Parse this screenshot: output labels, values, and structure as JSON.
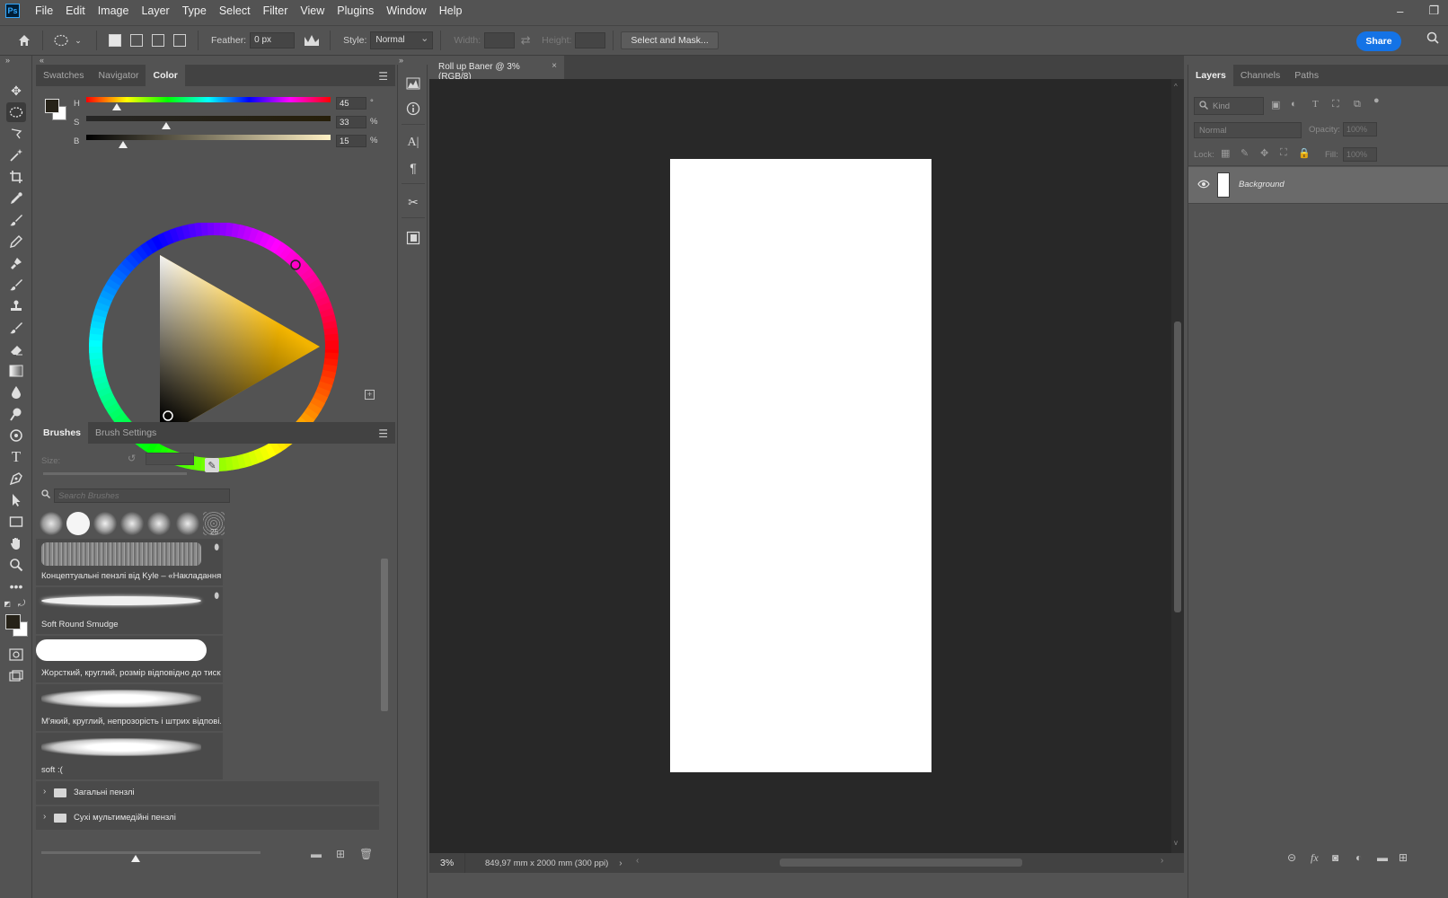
{
  "app": {
    "logo": "Ps",
    "menu": [
      "File",
      "Edit",
      "Image",
      "Layer",
      "Type",
      "Select",
      "Filter",
      "View",
      "Plugins",
      "Window",
      "Help"
    ],
    "window_controls": {
      "minimize": "–",
      "restore": "❐"
    }
  },
  "options_bar": {
    "feather_label": "Feather:",
    "feather_value": "0 px",
    "style_label": "Style:",
    "style_value": "Normal",
    "width_label": "Width:",
    "height_label": "Height:",
    "select_mask_label": "Select and Mask...",
    "share_label": "Share"
  },
  "color_panel": {
    "tabs": [
      "Swatches",
      "Navigator",
      "Color"
    ],
    "active_tab": "Color",
    "h": {
      "letter": "H",
      "value": "45",
      "unit": "°"
    },
    "s": {
      "letter": "S",
      "value": "33",
      "unit": "%"
    },
    "b": {
      "letter": "B",
      "value": "15",
      "unit": "%"
    },
    "foreground_color": "#262218",
    "background_color": "#ffffff"
  },
  "brushes_panel": {
    "tabs": [
      "Brushes",
      "Brush Settings"
    ],
    "active_tab": "Brushes",
    "size_label": "Size:",
    "search_placeholder": "Search Brushes",
    "recent_size_label": "25",
    "brushes": [
      {
        "name": "Концептуальні пензлі від Kyle – «Накладання ..."
      },
      {
        "name": "Soft Round Smudge"
      },
      {
        "name": "Жорсткий, круглий, розмір відповідно до тиску"
      },
      {
        "name": "М'який, круглий, непрозорість і штрих відпові..."
      },
      {
        "name": "soft :("
      }
    ],
    "groups": [
      {
        "name": "Загальні пензлі"
      },
      {
        "name": "Сухі мультимедійні пензлі"
      }
    ]
  },
  "document": {
    "tab_title": "Roll up Baner @ 3% (RGB/8)",
    "zoom": "3%",
    "info": "849,97 mm x 2000 mm (300 ppi)"
  },
  "layers_panel": {
    "tabs": [
      "Layers",
      "Channels",
      "Paths"
    ],
    "active_tab": "Layers",
    "filter_placeholder": "Kind",
    "blend_mode": "Normal",
    "opacity_label": "Opacity:",
    "opacity_value": "100%",
    "lock_label": "Lock:",
    "fill_label": "Fill:",
    "fill_value": "100%",
    "layers": [
      {
        "name": "Background",
        "visible": true
      }
    ]
  }
}
